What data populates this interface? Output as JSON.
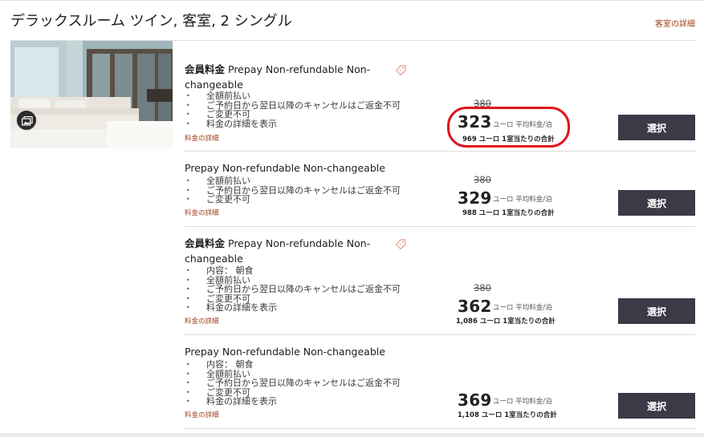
{
  "room": {
    "title": "デラックスルーム ツイン, 客室, 2 シングル",
    "details_link": "客室の詳細"
  },
  "rates": [
    {
      "member_label": "会員料金",
      "name": "Prepay Non-refundable Non-changeable",
      "bullets": [
        "全額前払い",
        "ご予約日から翌日以降のキャンセルはご返金不可",
        "ご変更不可",
        "料金の詳細を表示"
      ],
      "details_link": "料金の詳細",
      "original_price": "380",
      "price": "323",
      "per_night": "ユーロ 平均料金/泊",
      "total": "969 ユーロ 1室当たりの合計",
      "select_label": "選択",
      "highlighted": true
    },
    {
      "member_label": "",
      "name": "Prepay Non-refundable Non-changeable",
      "bullets": [
        "全額前払い",
        "ご予約日から翌日以降のキャンセルはご返金不可",
        "ご変更不可"
      ],
      "details_link": "料金の詳細",
      "original_price": "380",
      "price": "329",
      "per_night": "ユーロ 平均料金/泊",
      "total": "988 ユーロ 1室当たりの合計",
      "select_label": "選択"
    },
    {
      "member_label": "会員料金",
      "name": "Prepay Non-refundable Non-changeable",
      "bullets": [
        "内容： 朝食",
        "全額前払い",
        "ご予約日から翌日以降のキャンセルはご返金不可",
        "ご変更不可",
        "料金の詳細を表示"
      ],
      "details_link": "料金の詳細",
      "original_price": "380",
      "price": "362",
      "per_night": "ユーロ 平均料金/泊",
      "total": "1,086 ユーロ 1室当たりの合計",
      "select_label": "選択"
    },
    {
      "member_label": "",
      "name": "Prepay Non-refundable Non-changeable",
      "bullets": [
        "内容： 朝食",
        "全額前払い",
        "ご予約日から翌日以降のキャンセルはご返金不可",
        "ご変更不可",
        "料金の詳細を表示"
      ],
      "details_link": "料金の詳細",
      "price": "369",
      "per_night": "ユーロ 平均料金/泊",
      "total": "1,108 ユーロ 1室当たりの合計",
      "select_label": "選択"
    }
  ],
  "icons": {
    "gallery": "gallery-icon",
    "member_tag": "tag-icon"
  },
  "colors": {
    "link": "#a0421c",
    "button": "#3d3947",
    "highlight": "#e0141d"
  }
}
